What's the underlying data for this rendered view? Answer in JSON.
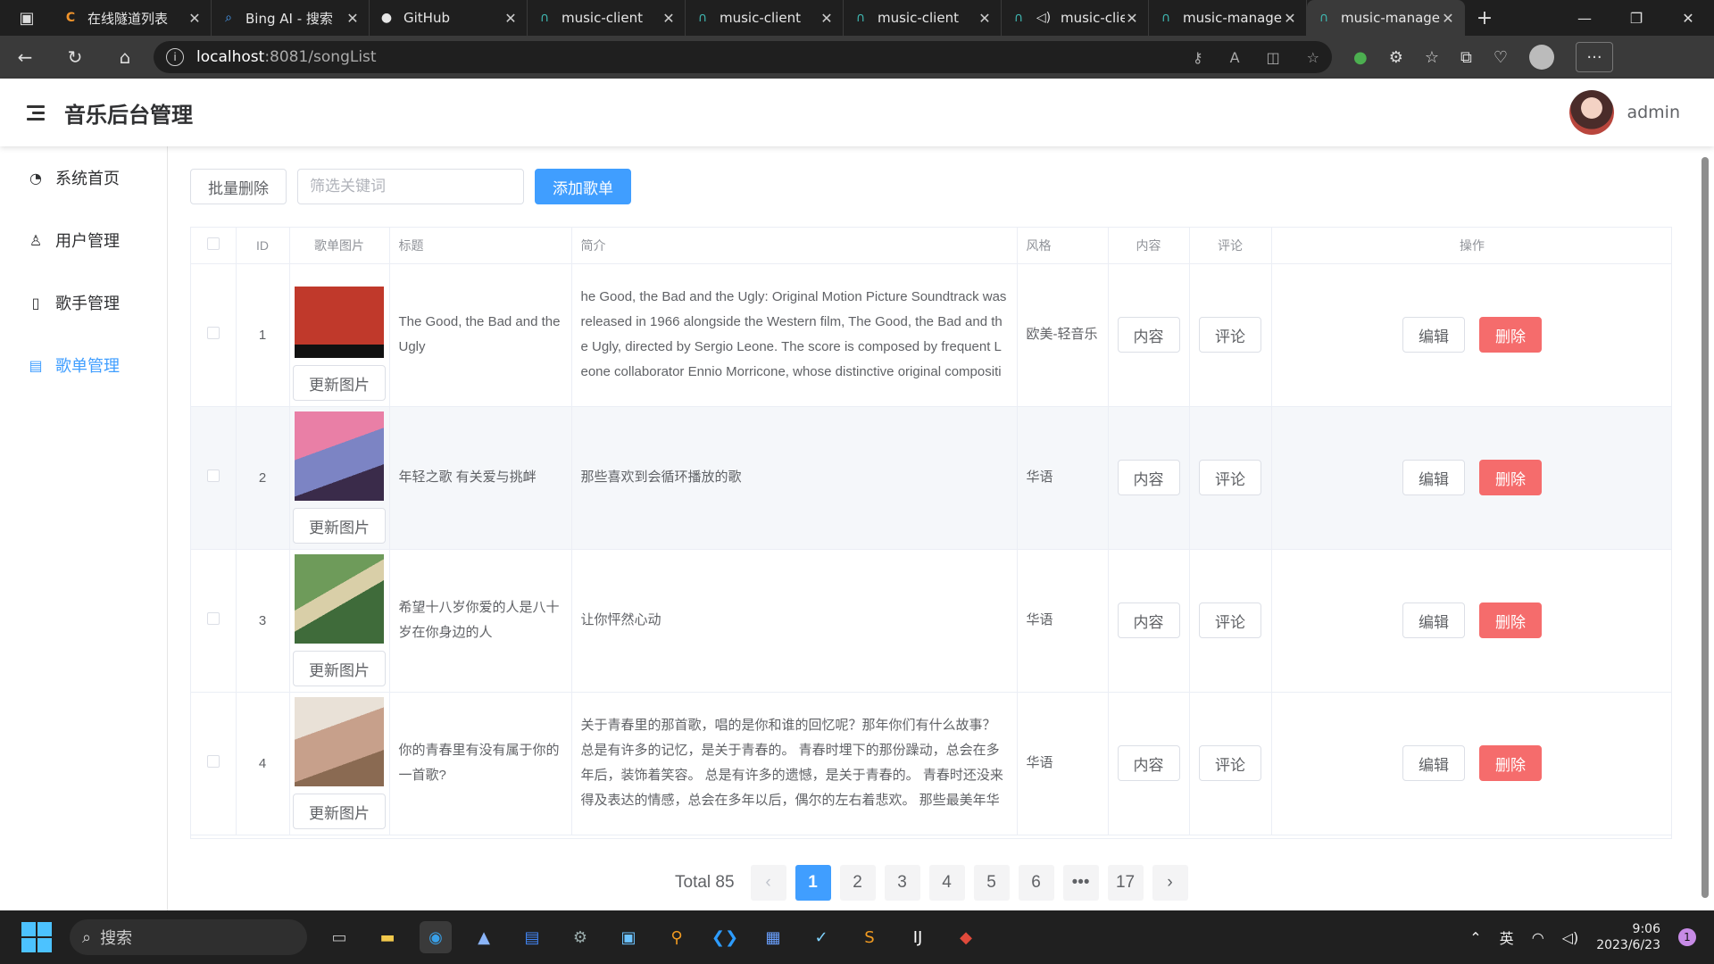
{
  "browser": {
    "tabs": [
      {
        "title": "在线隧道列表",
        "icon": "c-icon",
        "active": false
      },
      {
        "title": "Bing AI - 搜索",
        "icon": "search-icon",
        "active": false
      },
      {
        "title": "GitHub",
        "icon": "github-icon",
        "active": false
      },
      {
        "title": "music-client",
        "icon": "headphones-icon",
        "active": false
      },
      {
        "title": "music-client",
        "icon": "headphones-icon",
        "active": false
      },
      {
        "title": "music-client",
        "icon": "headphones-icon",
        "active": false
      },
      {
        "title": "music-clie",
        "icon": "headphones-icon",
        "active": false
      },
      {
        "title": "music-manage",
        "icon": "headphones-icon",
        "active": false
      },
      {
        "title": "music-manage",
        "icon": "headphones-icon",
        "active": true
      }
    ],
    "url_host": "localhost",
    "url_path": ":8081/songList"
  },
  "header": {
    "title": "音乐后台管理",
    "username": "admin"
  },
  "sidebar": {
    "items": [
      {
        "label": "系统首页",
        "icon": "pie-chart-icon",
        "active": false
      },
      {
        "label": "用户管理",
        "icon": "user-icon",
        "active": false
      },
      {
        "label": "歌手管理",
        "icon": "microphone-icon",
        "active": false
      },
      {
        "label": "歌单管理",
        "icon": "document-icon",
        "active": true
      }
    ]
  },
  "toolbar": {
    "batch_delete": "批量删除",
    "search_placeholder": "筛选关键词",
    "add_playlist": "添加歌单"
  },
  "table": {
    "headers": {
      "id": "ID",
      "cover": "歌单图片",
      "title": "标题",
      "intro": "简介",
      "style": "风格",
      "content": "内容",
      "comment": "评论",
      "actions": "操作"
    },
    "update_image_label": "更新图片",
    "content_label": "内容",
    "comment_label": "评论",
    "edit_label": "编辑",
    "delete_label": "删除",
    "rows": [
      {
        "id": "1",
        "title": "The Good, the Bad and the Ugly",
        "intro": "he Good, the Bad and the Ugly: Original Motion Picture Soundtrack was released in 1966 alongside the Western film, The Good, the Bad and the Ugly, directed by Sergio Leone. The score is composed by frequent Leone collaborator Ennio Morricone, whose distinctive original compositions, containing gunfire, whistling, and yodelling permeate the film. The main theme, resembling the howling of a coyote",
        "style": "欧美-轻音乐"
      },
      {
        "id": "2",
        "title": "年轻之歌 有关爱与挑衅",
        "intro": "那些喜欢到会循环播放的歌",
        "style": "华语"
      },
      {
        "id": "3",
        "title": "希望十八岁你爱的人是八十岁在你身边的人",
        "intro": "让你怦然心动",
        "style": "华语"
      },
      {
        "id": "4",
        "title": "你的青春里有没有属于你的一首歌?",
        "intro": "关于青春里的那首歌，唱的是你和谁的回忆呢？那年你们有什么故事？ 总是有许多的记忆，是关于青春的。 青春时埋下的那份躁动，总会在多年后，装饰着笑容。 总是有许多的遗憾，是关于青春的。 青春时还没来得及表达的情感，总会在多年以后，偶尔的左右着悲欢。 那些最美年华里的相遇，那些青春里的不知所措，都被勾勒成了一幅幅画。 而这些画，只有在某个特定时刻才会被悄悄翻起",
        "style": "华语"
      }
    ]
  },
  "pagination": {
    "total": "Total 85",
    "pages": [
      "1",
      "2",
      "3",
      "4",
      "5",
      "6"
    ],
    "ellipsis": "•••",
    "last": "17",
    "current": 1
  },
  "taskbar": {
    "search_placeholder": "搜索",
    "ime": "英",
    "time": "9:06",
    "date": "2023/6/23",
    "notifications": "1"
  }
}
